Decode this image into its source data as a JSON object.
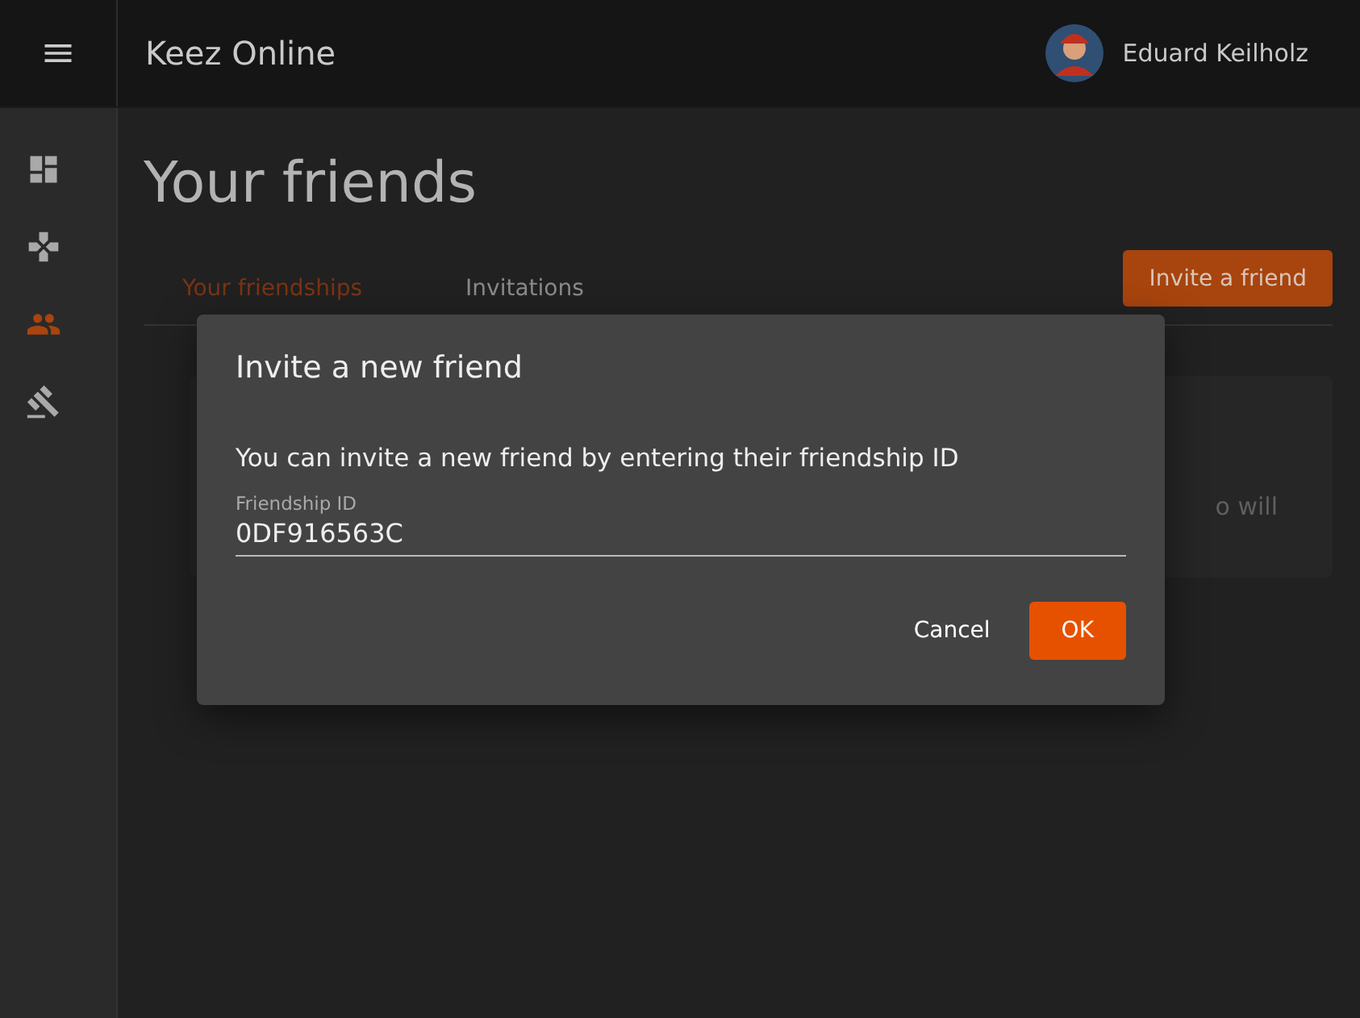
{
  "app_bar": {
    "title": "Keez Online",
    "user_name": "Eduard Keilholz"
  },
  "sidebar": {
    "items": [
      {
        "kind": "dashboard",
        "selected": false
      },
      {
        "kind": "games",
        "selected": false
      },
      {
        "kind": "friends",
        "selected": true
      },
      {
        "kind": "gavel",
        "selected": false
      }
    ]
  },
  "page": {
    "title": "Your friends",
    "tabs": [
      {
        "label": "Your friendships",
        "selected": true
      },
      {
        "label": "Invitations",
        "selected": false
      }
    ],
    "invite_button": "Invite a friend",
    "card_text": "o will"
  },
  "dialog": {
    "title": "Invite a new friend",
    "message": "You can invite a new friend by entering their friendship ID",
    "field": {
      "label": "Friendship ID",
      "value": "0DF916563C"
    },
    "buttons": [
      {
        "label": "Cancel",
        "kind": "text"
      },
      {
        "label": "OK",
        "kind": "primary"
      }
    ]
  }
}
